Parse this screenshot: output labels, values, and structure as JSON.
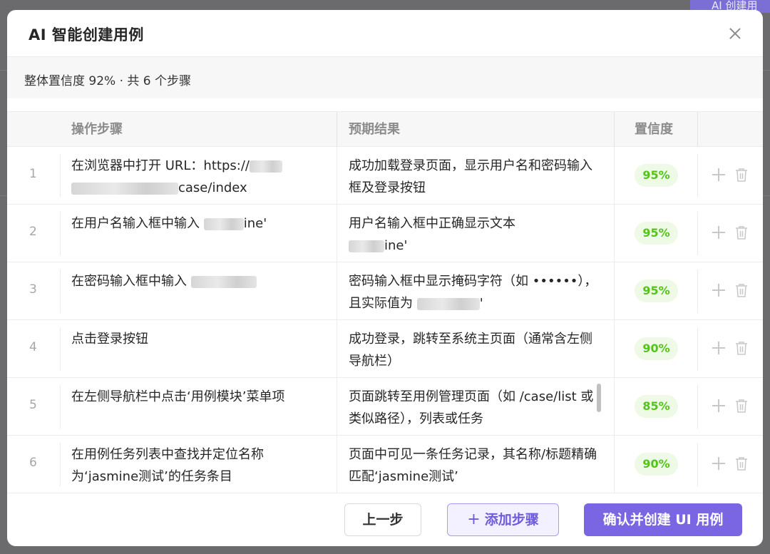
{
  "background": {
    "button_label": "AI 创建用"
  },
  "modal": {
    "title": "AI 智能创建用例",
    "summary": "整体置信度 92% · 共 6 个步骤",
    "columns": {
      "step": "操作步骤",
      "expected": "预期结果",
      "confidence": "置信度"
    },
    "rows": [
      {
        "num": "1",
        "step_a": "在浏览器中打开 URL：https://",
        "step_b": "case/index",
        "expected": "成功加载登录页面，显示用户名和密码输入框及登录按钮",
        "confidence": "95%"
      },
      {
        "num": "2",
        "step_a": "在用户名输入框中输入 ",
        "step_b": "ine'",
        "expected_a": "用户名输入框中正确显示文本",
        "expected_b": "ine'",
        "confidence": "95%"
      },
      {
        "num": "3",
        "step_a": "在密码输入框中输入 ",
        "expected_a": "密码输入框中显示掩码字符（如 ••••••），且实际值为 ",
        "expected_b": "'",
        "confidence": "95%"
      },
      {
        "num": "4",
        "step": "点击登录按钮",
        "expected": "成功登录，跳转至系统主页面（通常含左侧导航栏）",
        "confidence": "90%"
      },
      {
        "num": "5",
        "step": "在左侧导航栏中点击‘用例模块’菜单项",
        "expected": "页面跳转至用例管理页面（如 /case/list 或类似路径），列表或任务",
        "confidence": "85%"
      },
      {
        "num": "6",
        "step": "在用例任务列表中查找并定位名称为‘jasmine测试’的任务条目",
        "expected": "页面中可见一条任务记录，其名称/标题精确匹配‘jasmine测试’",
        "confidence": "90%"
      }
    ],
    "buttons": {
      "prev": "上一步",
      "add_plus": "+",
      "add": "添加步骤",
      "confirm": "确认并创建 UI 用例"
    }
  }
}
